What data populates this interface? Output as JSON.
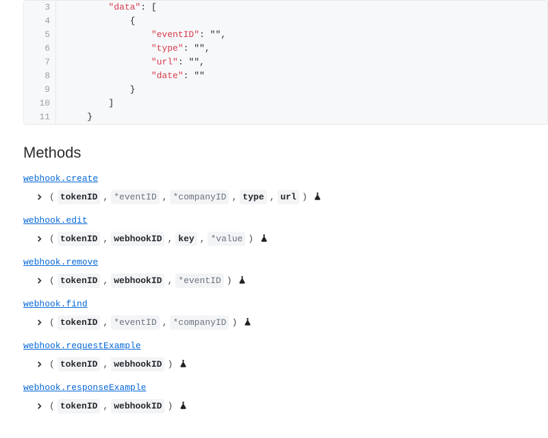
{
  "code": {
    "lines": [
      {
        "num": "3",
        "indent": "        ",
        "text_pre": "",
        "key": "\"data\"",
        "text_post": ": ["
      },
      {
        "num": "4",
        "indent": "            ",
        "text_pre": "{",
        "key": "",
        "text_post": ""
      },
      {
        "num": "5",
        "indent": "                ",
        "text_pre": "",
        "key": "\"eventID\"",
        "text_post": ": \"\","
      },
      {
        "num": "6",
        "indent": "                ",
        "text_pre": "",
        "key": "\"type\"",
        "text_post": ": \"\","
      },
      {
        "num": "7",
        "indent": "                ",
        "text_pre": "",
        "key": "\"url\"",
        "text_post": ": \"\","
      },
      {
        "num": "8",
        "indent": "                ",
        "text_pre": "",
        "key": "\"date\"",
        "text_post": ": \"\""
      },
      {
        "num": "9",
        "indent": "            ",
        "text_pre": "}",
        "key": "",
        "text_post": ""
      },
      {
        "num": "10",
        "indent": "        ",
        "text_pre": "]",
        "key": "",
        "text_post": ""
      },
      {
        "num": "11",
        "indent": "    ",
        "text_pre": "}",
        "key": "",
        "text_post": ""
      }
    ]
  },
  "methods_heading": "Methods",
  "punct": {
    "open": "(",
    "close": ")",
    "comma": ","
  },
  "methods": [
    {
      "name": "webhook.create",
      "params": [
        {
          "label": "tokenID",
          "strong": true
        },
        {
          "label": "*eventID",
          "strong": false
        },
        {
          "label": "*companyID",
          "strong": false
        },
        {
          "label": "type",
          "strong": true
        },
        {
          "label": "url",
          "strong": true
        }
      ]
    },
    {
      "name": "webhook.edit",
      "params": [
        {
          "label": "tokenID",
          "strong": true
        },
        {
          "label": "webhookID",
          "strong": true
        },
        {
          "label": "key",
          "strong": true
        },
        {
          "label": "*value",
          "strong": false
        }
      ]
    },
    {
      "name": "webhook.remove",
      "params": [
        {
          "label": "tokenID",
          "strong": true
        },
        {
          "label": "webhookID",
          "strong": true
        },
        {
          "label": "*eventID",
          "strong": false
        }
      ]
    },
    {
      "name": "webhook.find",
      "params": [
        {
          "label": "tokenID",
          "strong": true
        },
        {
          "label": "*eventID",
          "strong": false
        },
        {
          "label": "*companyID",
          "strong": false
        }
      ]
    },
    {
      "name": "webhook.requestExample",
      "params": [
        {
          "label": "tokenID",
          "strong": true
        },
        {
          "label": "webhookID",
          "strong": true
        }
      ]
    },
    {
      "name": "webhook.responseExample",
      "params": [
        {
          "label": "tokenID",
          "strong": true
        },
        {
          "label": "webhookID",
          "strong": true
        }
      ]
    }
  ]
}
